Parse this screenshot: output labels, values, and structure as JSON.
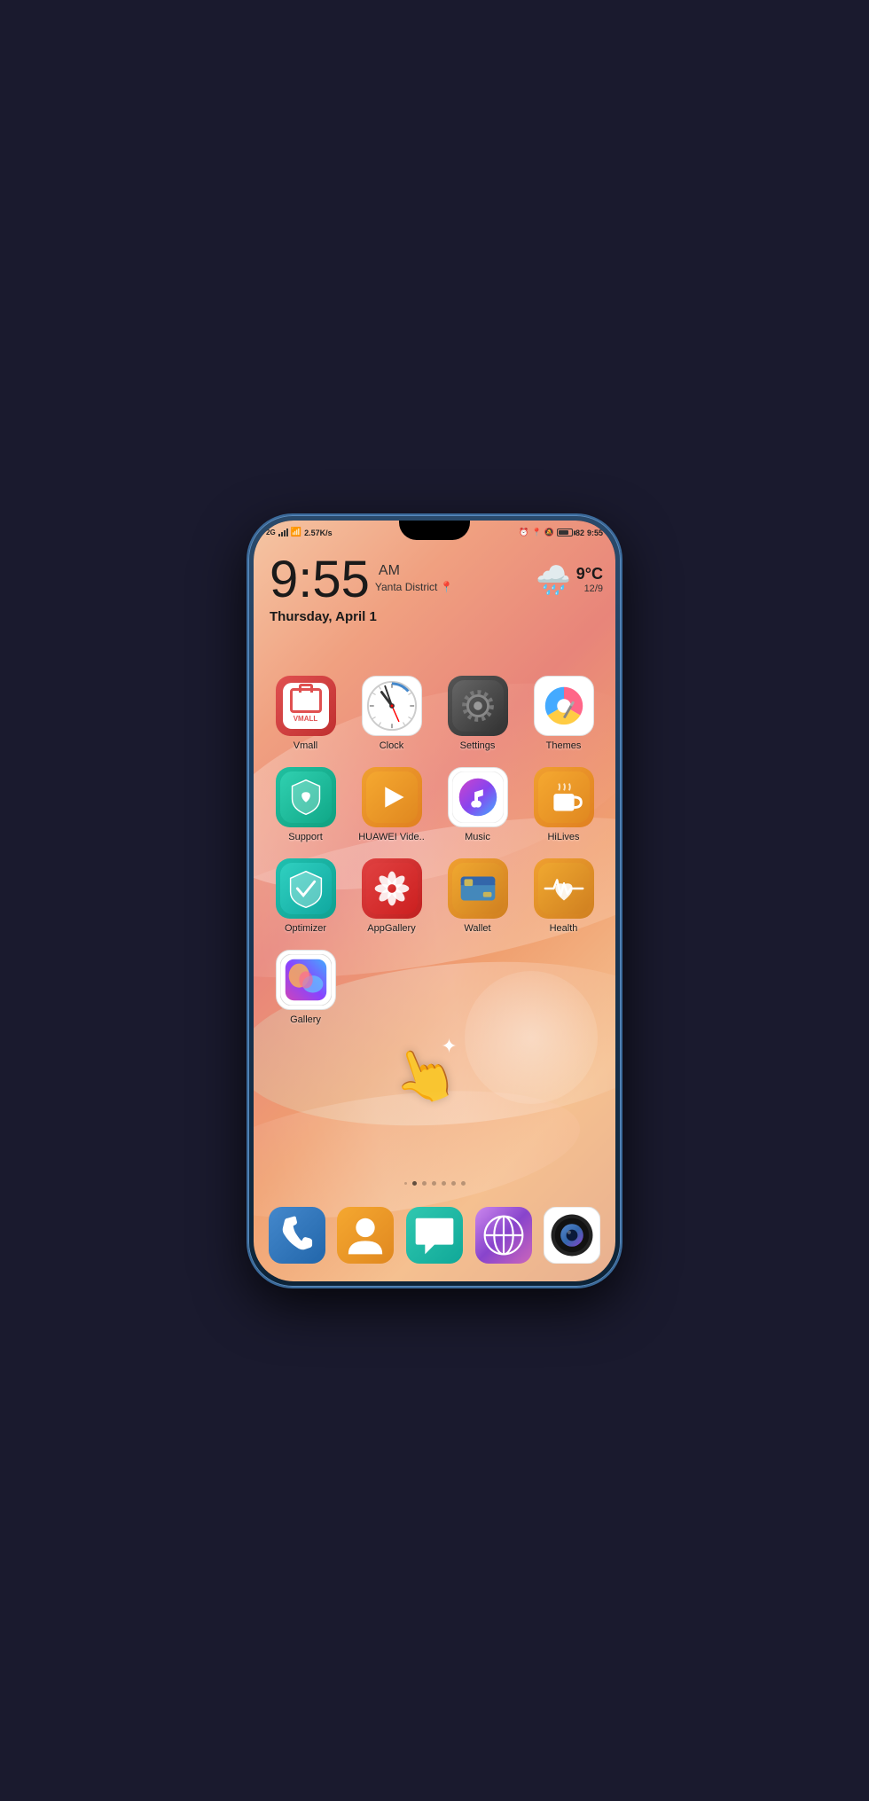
{
  "status": {
    "network": "2G",
    "speed": "2.57K/s",
    "battery_pct": "82",
    "time": "9:55",
    "alarm": "⏰",
    "location_pin": "📍",
    "bell": "🔕"
  },
  "clock_widget": {
    "time": "9:55",
    "ampm": "AM",
    "location": "Yanta District",
    "date": "Thursday, April 1"
  },
  "weather": {
    "temp": "9°C",
    "high": "12",
    "low": "9"
  },
  "apps": [
    {
      "id": "vmall",
      "label": "Vmall",
      "row": 0
    },
    {
      "id": "clock",
      "label": "Clock",
      "row": 0
    },
    {
      "id": "settings",
      "label": "Settings",
      "row": 0
    },
    {
      "id": "themes",
      "label": "Themes",
      "row": 0
    },
    {
      "id": "support",
      "label": "Support",
      "row": 1
    },
    {
      "id": "video",
      "label": "HUAWEI Vide..",
      "row": 1
    },
    {
      "id": "music",
      "label": "Music",
      "row": 1
    },
    {
      "id": "hilives",
      "label": "HiLives",
      "row": 1
    },
    {
      "id": "optimizer",
      "label": "Optimizer",
      "row": 2
    },
    {
      "id": "appgallery",
      "label": "AppGallery",
      "row": 2
    },
    {
      "id": "wallet",
      "label": "Wallet",
      "row": 2
    },
    {
      "id": "health",
      "label": "Health",
      "row": 2
    },
    {
      "id": "gallery",
      "label": "Gallery",
      "row": 3
    }
  ],
  "dock": [
    {
      "id": "phone",
      "label": "Phone"
    },
    {
      "id": "contacts",
      "label": "Contacts"
    },
    {
      "id": "messages",
      "label": "Messages"
    },
    {
      "id": "browser",
      "label": "Browser"
    },
    {
      "id": "camera",
      "label": "Camera"
    }
  ],
  "page_dots": {
    "total": 6,
    "active": 1
  }
}
